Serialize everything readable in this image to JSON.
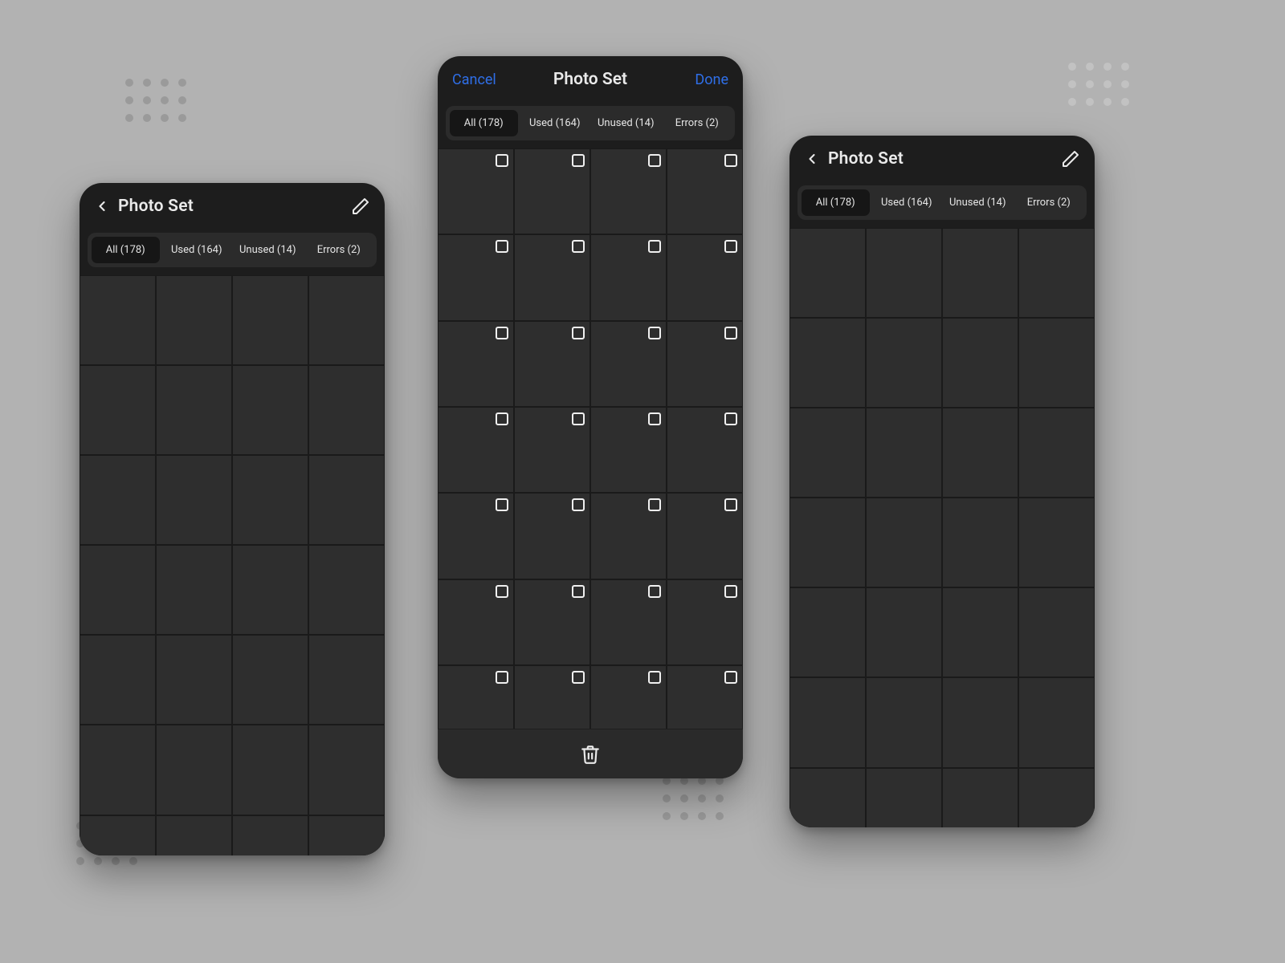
{
  "title": "Photo Set",
  "cancel_label": "Cancel",
  "done_label": "Done",
  "accent_color": "#2f6fe8",
  "tabs": [
    {
      "label": "All (178)",
      "active": true
    },
    {
      "label": "Used (164)",
      "active": false
    },
    {
      "label": "Unused (14)",
      "active": false
    },
    {
      "label": "Errors (2)",
      "active": false
    }
  ],
  "counts": {
    "all": 178,
    "used": 164,
    "unused": 14,
    "errors": 2
  },
  "screens": {
    "browse": {
      "rows": 7,
      "cols": 4,
      "checkboxes": false,
      "hasEdit": true,
      "hasBack": true
    },
    "select": {
      "rows": 7,
      "cols": 4,
      "checkboxes": true,
      "hasCancel": true,
      "hasDone": true,
      "hasDelete": true
    },
    "browse2": {
      "rows": 7,
      "cols": 4,
      "checkboxes": false,
      "hasEdit": true,
      "hasBack": true
    }
  },
  "icons": {
    "back": "chevron-left-icon",
    "edit": "pencil-icon",
    "delete": "trash-icon"
  }
}
